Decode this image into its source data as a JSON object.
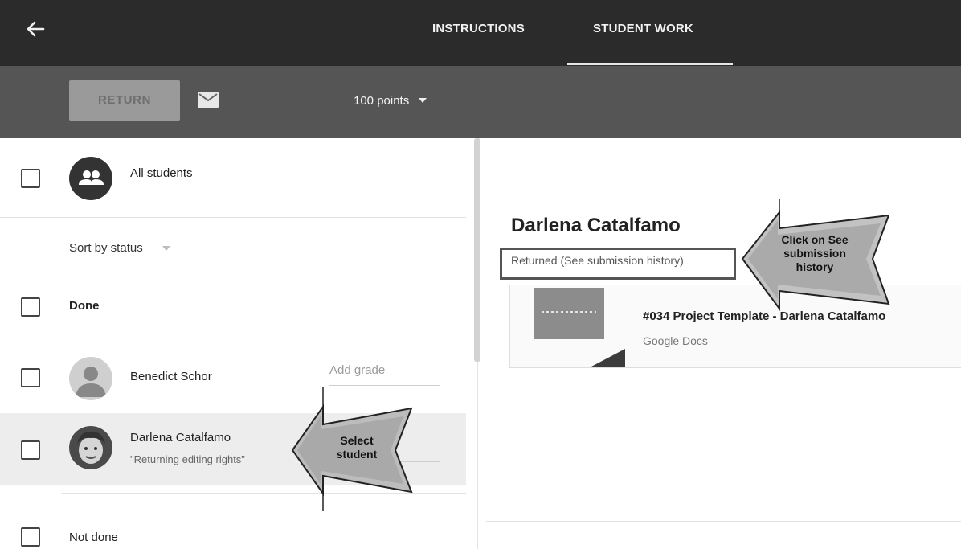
{
  "topbar": {
    "back_icon": "arrow-left-icon",
    "tabs": [
      {
        "label": "INSTRUCTIONS",
        "active": false
      },
      {
        "label": "STUDENT WORK",
        "active": true
      }
    ]
  },
  "toolbar": {
    "return_label": "RETURN",
    "mail_icon": "mail-icon",
    "points_value": "100 points"
  },
  "student_list": {
    "all_students_label": "All students",
    "sort_label": "Sort by status",
    "sections": [
      {
        "label": "Done"
      },
      {
        "label": "Not done"
      }
    ],
    "students": [
      {
        "name": "Benedict Schor",
        "grade_placeholder": "Add grade",
        "comment": "",
        "selected": false
      },
      {
        "name": "Darlena Catalfamo",
        "grade_placeholder": "",
        "comment": "\"Returning editing rights\"",
        "selected": true
      }
    ]
  },
  "callouts": {
    "select_student": "Select student",
    "see_history": "Click on See submission history"
  },
  "detail": {
    "student_name": "Darlena Catalfamo",
    "status_text": "Returned (See submission history)",
    "attachment": {
      "title": "#034 Project Template - Darlena Catalfamo",
      "type": "Google Docs"
    }
  },
  "colors": {
    "topbar_bg": "#2b2b2b",
    "toolbar_bg": "#555555",
    "selected_row_bg": "#ededed"
  }
}
